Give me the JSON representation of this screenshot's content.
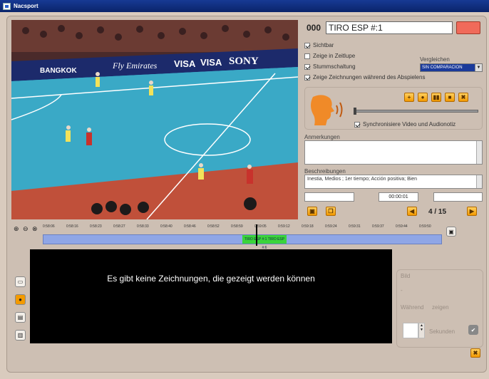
{
  "window": {
    "title": "Nacsport"
  },
  "header": {
    "counter": "000",
    "clip_name": "TIRO ESP #:1",
    "color": "#f06a5a"
  },
  "options": [
    {
      "label": "Sichtbar",
      "checked": true
    },
    {
      "label": "Zeige in Zeitlupe",
      "checked": false
    },
    {
      "label": "Stummschaltung",
      "checked": true
    },
    {
      "label": "Zeige Zeichnungen während des Abspielens",
      "checked": true
    }
  ],
  "compare": {
    "label": "Vergleichen",
    "selected": "SIN COMPARACION"
  },
  "audio": {
    "sync_label": "Synchronisiere Video und Audionotiz",
    "sync_checked": true
  },
  "annotations": {
    "label": "Anmerkungen",
    "value": ""
  },
  "descriptions": {
    "label": "Beschreibungen",
    "value": "Inestia, Medios ; 1er tiempo; Acción positiva; Bien"
  },
  "timecode": {
    "value": "00:00:01"
  },
  "navigation": {
    "position": "4 / 15"
  },
  "timeline": {
    "ticks": [
      "0:58:06",
      "0:58:16",
      "0:58:23",
      "0:58:27",
      "0:58:33",
      "0:58:40",
      "0:58:46",
      "0:58:52",
      "0:58:59",
      "0:59:05",
      "0:59:12",
      "0:59:18",
      "0:59:24",
      "0:59:31",
      "0:59:37",
      "0:59:44",
      "0:59:50"
    ],
    "clip_label": "TIRO ESP #:1 TIRO ESP #:6"
  },
  "drawing": {
    "empty_message": "Es gibt keine Zeichnungen, die gezeigt werden können"
  },
  "side_panel": {
    "bild_label": "Bild",
    "dash": "-",
    "duration_label": "Während",
    "zeigen_label": "zeigen",
    "seconds_label": "Sekunden"
  },
  "video": {
    "banners": [
      "BANGKOK",
      "Fly Emirates",
      "VISA",
      "VISA",
      "SONY"
    ]
  }
}
